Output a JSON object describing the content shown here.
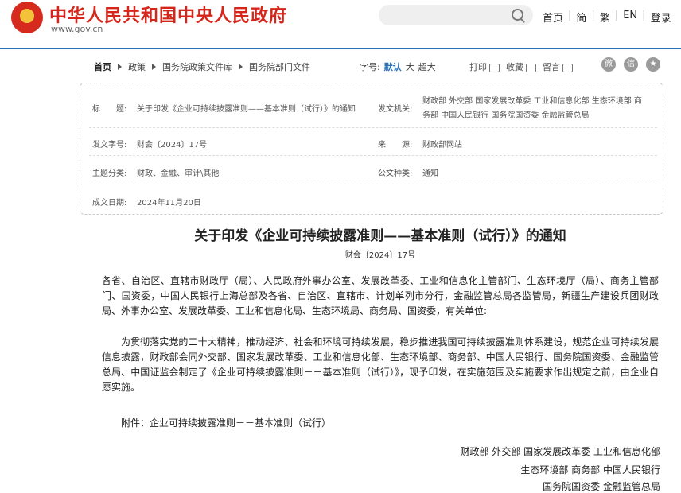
{
  "header": {
    "site_title": "中华人民共和国中央人民政府",
    "site_url": "www.gov.cn",
    "nav": [
      "首页",
      "简",
      "繁",
      "EN",
      "登录"
    ]
  },
  "breadcrumb": [
    "首页",
    "政策",
    "国务院政策文件库",
    "国务院部门文件"
  ],
  "font_size": {
    "label": "字号:",
    "options": [
      "默认",
      "大",
      "超大"
    ]
  },
  "tools": {
    "print": "打印",
    "favorite": "收藏",
    "comment": "留言"
  },
  "share_icons": [
    "weibo-icon",
    "wechat-icon",
    "more-icon"
  ],
  "meta": {
    "title_label": "标　　题:",
    "title_value": "关于印发《企业可持续披露准则——基本准则（试行）》的通知",
    "issuer_label": "发文机关:",
    "issuer_line1": "财政部  外交部  国家发展改革委  工业和信息化部  生态环境部  商",
    "issuer_line2": "务部  中国人民银行  国务院国资委  金融监管总局",
    "docno_label": "发文字号:",
    "docno_value": "财会〔2024〕17号",
    "source_label": "来　　源:",
    "source_value": "财政部网站",
    "topic_label": "主题分类:",
    "topic_value": "财政、金融、审计\\其他",
    "type_label": "公文种类:",
    "type_value": "通知",
    "date_label": "成文日期:",
    "date_value": "2024年11月20日"
  },
  "doc": {
    "title": "关于印发《企业可持续披露准则——基本准则（试行）》的通知",
    "number": "财会〔2024〕17号",
    "para1": "各省、自治区、直辖市财政厅（局）、人民政府外事办公室、发展改革委、工业和信息化主管部门、生态环境厅（局）、商务主管部门、国资委，中国人民银行上海总部及各省、自治区、直辖市、计划单列市分行，金融监管总局各监管局，新疆生产建设兵团财政局、外事办公室、发展改革委、工业和信息化局、生态环境局、商务局、国资委，有关单位:",
    "para2": "为贯彻落实党的二十大精神，推动经济、社会和环境可持续发展，稳步推进我国可持续披露准则体系建设，规范企业可持续发展信息披露，财政部会同外交部、国家发展改革委、工业和信息化部、生态环境部、商务部、中国人民银行、国务院国资委、金融监管总局、中国证监会制定了《企业可持续披露准则－－基本准则（试行）》，现予印发，在实施范围及实施要求作出规定之前，由企业自愿实施。",
    "attachment": "附件：企业可持续披露准则－－基本准则（试行）",
    "sign1": "财政部  外交部  国家发展改革委  工业和信息化部",
    "sign2": "生态环境部  商务部  中国人民银行",
    "sign3": "国务院国资委  金融监管总局"
  },
  "colors": {
    "brand_red": "#d6261c",
    "link_blue": "#2b6fb6"
  }
}
